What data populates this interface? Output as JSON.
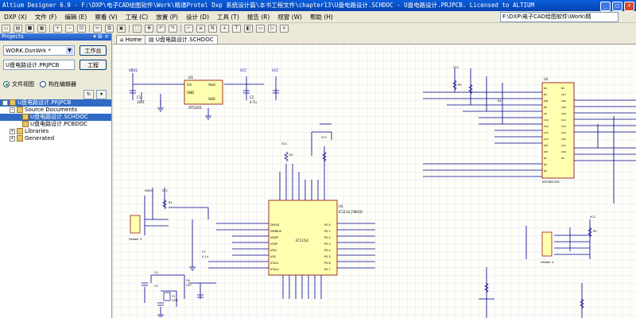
{
  "window": {
    "title": "Altium Designer 6.9 - F:\\DXP\\电子CAD绘图软件\\Work\\精通Protel Dxp 系统设计篇\\本书工程文件\\chapter13\\U盘电路设计.SCHDOC - U盘电路设计.PRJPCB. Licensed to ALTIUM",
    "buttons": [
      "_",
      "□",
      "×"
    ]
  },
  "menubar": {
    "items": [
      "DXP (X)",
      "文件 (F)",
      "编辑 (E)",
      "察看 (V)",
      "工程 (C)",
      "放置 (P)",
      "设计 (D)",
      "工具 (T)",
      "报告 (R)",
      "视窗 (W)",
      "帮助 (H)"
    ],
    "path": "F:\\DXP\\电子CAD绘图软件\\Work\\精"
  },
  "panel": {
    "title": "Projects",
    "workspace": "WORK.DsnWrk *",
    "workspace_btn": "工作台",
    "project": "U盘电路设计.PRJPCB",
    "project_btn": "工程",
    "radio_file_view": "文件视图",
    "radio_struct_editor": "构在编辑器",
    "tree": [
      {
        "label": "U盘电路设计.PRJPCB",
        "level": 0
      },
      {
        "label": "Source Documents",
        "level": 1
      },
      {
        "label": "U盘电路设计.SCHDOC",
        "level": 2
      },
      {
        "label": "U盘电路设计.PCBDOC",
        "level": 2
      },
      {
        "label": "Libraries",
        "level": 1
      },
      {
        "label": "Generated",
        "level": 1
      }
    ]
  },
  "tabs": {
    "home": "Home",
    "doc": "U盘电路设计.SCHDOC"
  },
  "schematic": {
    "u1_label": "U1",
    "u1_part": "AT1201",
    "u1_pins": [
      "Vin",
      "GND",
      "Vout",
      "SHD"
    ],
    "u2_label": "U2",
    "u2_part": "K9F080UOM",
    "u3_label": "U3",
    "u3_part": "IC1114_F80GQ",
    "u3_name": "IC1114",
    "pwr": "VCC",
    "pwr2": "VBUS",
    "j1": "Header 4",
    "j2": "Header 4",
    "labels": [
      "C1",
      "C2",
      "C3",
      "C4",
      "C5",
      "C6",
      "C7",
      "C8",
      "R1",
      "R2",
      "R3",
      "R4",
      "R5",
      "Y1",
      "12M",
      "10uF",
      "4.7u",
      "0.1u",
      "22P"
    ],
    "u2_left_pins": [
      "NC",
      "NC",
      "NC",
      "NC",
      "NC",
      "NC",
      "R/B",
      "RE",
      "CE",
      "NC",
      "NC",
      "VCC",
      "VSS",
      "NC",
      "NC",
      "CLE",
      "ALE",
      "WE",
      "WP",
      "NC",
      "NC",
      "NC",
      "NC",
      "NC"
    ],
    "u2_right_pins": [
      "NC",
      "NC",
      "NC",
      "NC",
      "I/O7",
      "I/O6",
      "I/O5",
      "I/O4",
      "NC",
      "NC",
      "NC",
      "VCC",
      "VSS",
      "NC",
      "NC",
      "NC",
      "I/O3",
      "I/O2",
      "I/O1",
      "I/O0",
      "NC",
      "NC",
      "NC",
      "NC"
    ],
    "u3_left_pins": [
      "DPLUS",
      "DMINUS",
      "VDDP",
      "VSSP",
      "VDD",
      "VSS",
      "XTAL1",
      "XTAL2",
      "RC",
      "NC"
    ],
    "u3_right_pins": [
      "P0.0",
      "P0.1",
      "P0.2",
      "P0.3",
      "P0.4",
      "P0.5",
      "P0.6",
      "P0.7",
      "ALE",
      "RD",
      "WR",
      "P2.0"
    ]
  }
}
